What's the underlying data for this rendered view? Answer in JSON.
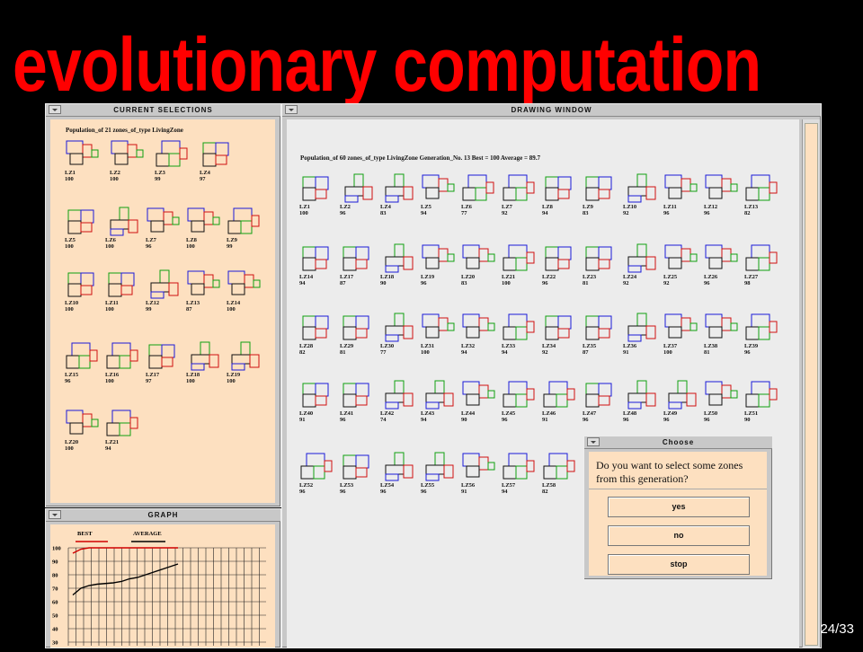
{
  "slide_title": "evolutionary computation",
  "page_number": "24/33",
  "current_selections": {
    "title": "CURRENT SELECTIONS",
    "population_text": "Population_of 21 zones_of_type LivingZone",
    "zones": [
      {
        "name": "LZ1",
        "score": "100"
      },
      {
        "name": "LZ2",
        "score": "100"
      },
      {
        "name": "LZ3",
        "score": "99"
      },
      {
        "name": "LZ4",
        "score": "97"
      },
      {
        "name": "LZ5",
        "score": "100"
      },
      {
        "name": "LZ6",
        "score": "100"
      },
      {
        "name": "LZ7",
        "score": "96"
      },
      {
        "name": "LZ8",
        "score": "100"
      },
      {
        "name": "LZ9",
        "score": "99"
      },
      {
        "name": "LZ10",
        "score": "100"
      },
      {
        "name": "LZ11",
        "score": "100"
      },
      {
        "name": "LZ12",
        "score": "99"
      },
      {
        "name": "LZ13",
        "score": "87"
      },
      {
        "name": "LZ14",
        "score": "100"
      },
      {
        "name": "LZ15",
        "score": "96"
      },
      {
        "name": "LZ16",
        "score": "100"
      },
      {
        "name": "LZ17",
        "score": "97"
      },
      {
        "name": "LZ18",
        "score": "100"
      },
      {
        "name": "LZ19",
        "score": "100"
      },
      {
        "name": "LZ20",
        "score": "100"
      },
      {
        "name": "LZ21",
        "score": "94"
      }
    ]
  },
  "graph": {
    "title": "GRAPH",
    "legend_best": "BEST",
    "legend_average": "AVERAGE",
    "best_color": "#d00000",
    "average_color": "#000000",
    "y_ticks": [
      "100",
      "90",
      "80",
      "70",
      "60",
      "50",
      "40",
      "30"
    ],
    "best_values": [
      96,
      99,
      100,
      100,
      100,
      100,
      100,
      100,
      100,
      100,
      100,
      100,
      100,
      100
    ],
    "average_values": [
      65,
      70,
      72,
      73,
      73.5,
      74,
      75,
      77,
      78,
      80,
      82,
      84,
      86,
      88
    ]
  },
  "drawing_window": {
    "title": "DRAWING WINDOW",
    "header_text": "Population_of 60 zones_of_type LivingZone Generation_No. 13 Best = 100 Average = 89.7",
    "zones": [
      {
        "name": "LZ1",
        "score": "100"
      },
      {
        "name": "LZ2",
        "score": "96"
      },
      {
        "name": "LZ4",
        "score": "83"
      },
      {
        "name": "LZ5",
        "score": "94"
      },
      {
        "name": "LZ6",
        "score": "77"
      },
      {
        "name": "LZ7",
        "score": "92"
      },
      {
        "name": "LZ8",
        "score": "94"
      },
      {
        "name": "LZ9",
        "score": "83"
      },
      {
        "name": "LZ10",
        "score": "92"
      },
      {
        "name": "LZ11",
        "score": "96"
      },
      {
        "name": "LZ12",
        "score": "96"
      },
      {
        "name": "LZ13",
        "score": "82"
      },
      {
        "name": "LZ14",
        "score": "94"
      },
      {
        "name": "LZ17",
        "score": "87"
      },
      {
        "name": "LZ18",
        "score": "90"
      },
      {
        "name": "LZ19",
        "score": "96"
      },
      {
        "name": "LZ20",
        "score": "83"
      },
      {
        "name": "LZ21",
        "score": "100"
      },
      {
        "name": "LZ22",
        "score": "96"
      },
      {
        "name": "LZ23",
        "score": "81"
      },
      {
        "name": "LZ24",
        "score": "92"
      },
      {
        "name": "LZ25",
        "score": "92"
      },
      {
        "name": "LZ26",
        "score": "96"
      },
      {
        "name": "LZ27",
        "score": "98"
      },
      {
        "name": "LZ28",
        "score": "82"
      },
      {
        "name": "LZ29",
        "score": "81"
      },
      {
        "name": "LZ30",
        "score": "77"
      },
      {
        "name": "LZ31",
        "score": "100"
      },
      {
        "name": "LZ32",
        "score": "94"
      },
      {
        "name": "LZ33",
        "score": "94"
      },
      {
        "name": "LZ34",
        "score": "92"
      },
      {
        "name": "LZ35",
        "score": "87"
      },
      {
        "name": "LZ36",
        "score": "91"
      },
      {
        "name": "LZ37",
        "score": "100"
      },
      {
        "name": "LZ38",
        "score": "81"
      },
      {
        "name": "LZ39",
        "score": "96"
      },
      {
        "name": "LZ40",
        "score": "91"
      },
      {
        "name": "LZ41",
        "score": "96"
      },
      {
        "name": "LZ42",
        "score": "74"
      },
      {
        "name": "LZ43",
        "score": "94"
      },
      {
        "name": "LZ44",
        "score": "90"
      },
      {
        "name": "LZ45",
        "score": "96"
      },
      {
        "name": "LZ46",
        "score": "91"
      },
      {
        "name": "LZ47",
        "score": "96"
      },
      {
        "name": "LZ48",
        "score": "96"
      },
      {
        "name": "LZ49",
        "score": "96"
      },
      {
        "name": "LZ50",
        "score": "96"
      },
      {
        "name": "LZ51",
        "score": "90"
      },
      {
        "name": "LZ52",
        "score": "96"
      },
      {
        "name": "LZ53",
        "score": "96"
      },
      {
        "name": "LZ54",
        "score": "96"
      },
      {
        "name": "LZ55",
        "score": "96"
      },
      {
        "name": "LZ56",
        "score": "91"
      },
      {
        "name": "LZ57",
        "score": "94"
      },
      {
        "name": "LZ58",
        "score": "82"
      }
    ]
  },
  "choose_dialog": {
    "title": "Choose",
    "question_line1": "Do you want to select some zones",
    "question_line2": "from this generation?",
    "buttons": [
      "yes",
      "no",
      "stop"
    ]
  },
  "colors": {
    "blue": "#1a1ad8",
    "red": "#d01010",
    "green": "#10a010",
    "black": "#111111",
    "panel_bg": "#fde0c0",
    "drawing_bg": "#ececec"
  }
}
